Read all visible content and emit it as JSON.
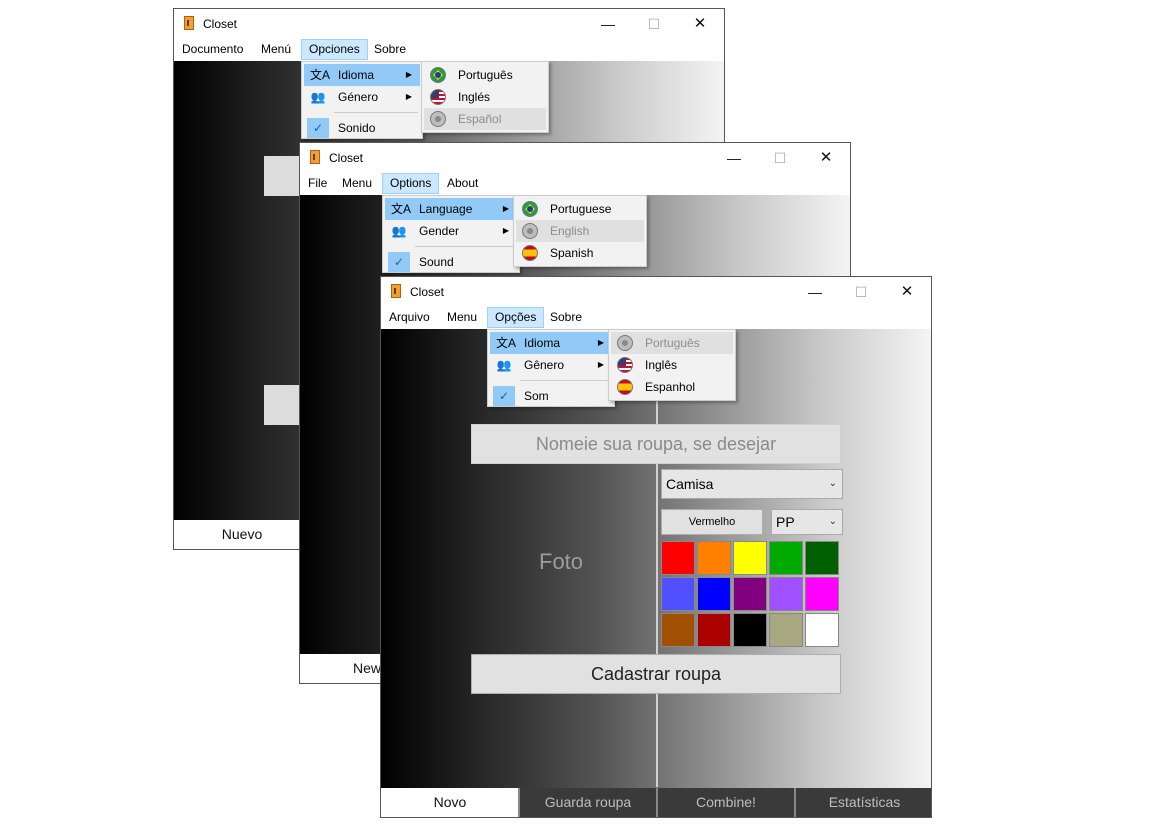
{
  "windows": [
    {
      "title": "Closet",
      "menu": [
        "Documento",
        "Menú",
        "Opciones",
        "Sobre"
      ],
      "popup": {
        "language": "Idioma",
        "gender": "Género",
        "sound": "Sonido"
      },
      "languages": [
        "Português",
        "Inglés",
        "Español"
      ],
      "tab_active": "Nuevo"
    },
    {
      "title": "Closet",
      "menu": [
        "File",
        "Menu",
        "Options",
        "About"
      ],
      "popup": {
        "language": "Language",
        "gender": "Gender",
        "sound": "Sound"
      },
      "languages": [
        "Portuguese",
        "English",
        "Spanish"
      ],
      "tab_active": "New"
    },
    {
      "title": "Closet",
      "menu": [
        "Arquivo",
        "Menu",
        "Opções",
        "Sobre"
      ],
      "popup": {
        "language": "Idioma",
        "gender": "Gênero",
        "sound": "Som"
      },
      "languages": [
        "Português",
        "Inglês",
        "Espanhol"
      ],
      "tabs": [
        "Novo",
        "Guarda roupa",
        "Combine!",
        "Estatísticas"
      ],
      "form": {
        "name_placeholder": "Nomeie sua roupa, se desejar",
        "photo_label": "Foto",
        "type_value": "Camisa",
        "color_button": "Vermelho",
        "size_value": "PP",
        "submit": "Cadastrar roupa"
      }
    }
  ],
  "window_controls": {
    "minimize": "—",
    "maximize": "☐",
    "close": "✕"
  },
  "icons": {
    "language": "translate-icon",
    "gender": "gender-icon",
    "sound_check": "checkmark-icon",
    "submenu": "chevron-right-icon",
    "dropdown": "chevron-down-icon"
  },
  "icon_glyphs": {
    "translate": "文A",
    "gender": "👥",
    "check": "✓",
    "arrow": "▶",
    "dropdown": "⌄"
  },
  "palette": [
    "#ff0000",
    "#ff8000",
    "#ffff00",
    "#00aa00",
    "#006000",
    "#5050ff",
    "#0000ff",
    "#800080",
    "#a050ff",
    "#ff00ff",
    "#a05000",
    "#aa0000",
    "#000000",
    "#a8a880",
    "#ffffff"
  ]
}
